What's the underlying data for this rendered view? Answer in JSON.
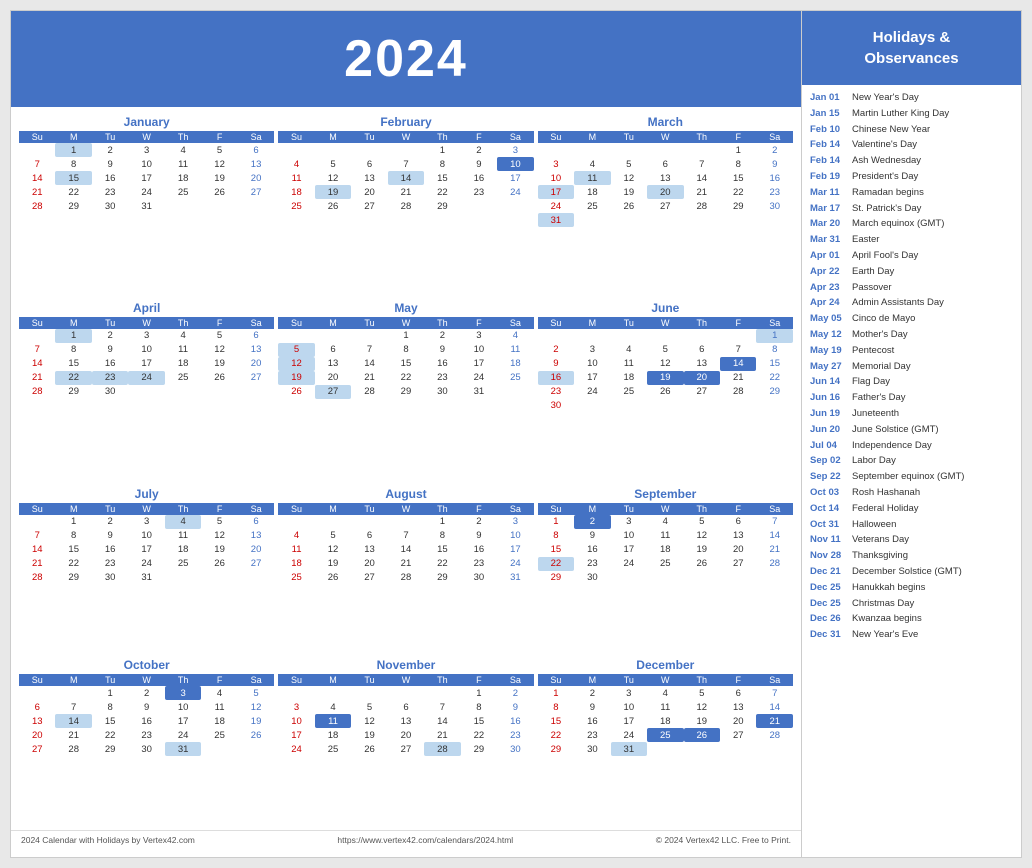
{
  "header": {
    "year": "2024"
  },
  "months": [
    {
      "name": "January",
      "days_in_month": 31,
      "start_day": 1,
      "highlights": [
        1,
        15
      ],
      "saturday_highlights": [],
      "rows": [
        [
          "",
          "1",
          "2",
          "3",
          "4",
          "5",
          "6"
        ],
        [
          "7",
          "8",
          "9",
          "10",
          "11",
          "12",
          "13"
        ],
        [
          "14",
          "15",
          "16",
          "17",
          "18",
          "19",
          "20"
        ],
        [
          "21",
          "22",
          "23",
          "24",
          "25",
          "26",
          "27"
        ],
        [
          "28",
          "29",
          "30",
          "31",
          "",
          "",
          ""
        ]
      ]
    },
    {
      "name": "February",
      "rows": [
        [
          "",
          "",
          "",
          "",
          "1",
          "2",
          "3"
        ],
        [
          "4",
          "5",
          "6",
          "7",
          "8",
          "9",
          "10"
        ],
        [
          "11",
          "12",
          "13",
          "14",
          "15",
          "16",
          "17"
        ],
        [
          "18",
          "19",
          "20",
          "21",
          "22",
          "23",
          "24"
        ],
        [
          "25",
          "26",
          "27",
          "28",
          "29",
          "",
          ""
        ]
      ],
      "highlights": [
        10,
        14,
        19
      ],
      "blue_highlights": [
        3,
        10
      ]
    },
    {
      "name": "March",
      "rows": [
        [
          "",
          "",
          "",
          "",
          "",
          "1",
          "2"
        ],
        [
          "3",
          "4",
          "5",
          "6",
          "7",
          "8",
          "9"
        ],
        [
          "10",
          "11",
          "12",
          "13",
          "14",
          "15",
          "16"
        ],
        [
          "17",
          "18",
          "19",
          "20",
          "21",
          "22",
          "23"
        ],
        [
          "24",
          "25",
          "26",
          "27",
          "28",
          "29",
          "30"
        ],
        [
          "31",
          "",
          "",
          "",
          "",
          "",
          ""
        ]
      ],
      "highlights": [
        11,
        17,
        20,
        31
      ]
    },
    {
      "name": "April",
      "rows": [
        [
          "",
          "1",
          "2",
          "3",
          "4",
          "5",
          "6"
        ],
        [
          "7",
          "8",
          "9",
          "10",
          "11",
          "12",
          "13"
        ],
        [
          "14",
          "15",
          "16",
          "17",
          "18",
          "19",
          "20"
        ],
        [
          "21",
          "22",
          "23",
          "24",
          "25",
          "26",
          "27"
        ],
        [
          "28",
          "29",
          "30",
          "",
          "",
          "",
          ""
        ]
      ],
      "highlights": [
        1,
        22,
        23,
        24
      ]
    },
    {
      "name": "May",
      "rows": [
        [
          "",
          "",
          "",
          "1",
          "2",
          "3",
          "4"
        ],
        [
          "5",
          "6",
          "7",
          "8",
          "9",
          "10",
          "11"
        ],
        [
          "12",
          "13",
          "14",
          "15",
          "16",
          "17",
          "18"
        ],
        [
          "19",
          "20",
          "21",
          "22",
          "23",
          "24",
          "25"
        ],
        [
          "26",
          "27",
          "28",
          "29",
          "30",
          "31",
          ""
        ]
      ],
      "highlights": [
        5,
        12,
        19,
        27
      ]
    },
    {
      "name": "June",
      "rows": [
        [
          "",
          "",
          "",
          "",
          "",
          "",
          "1"
        ],
        [
          "2",
          "3",
          "4",
          "5",
          "6",
          "7",
          "8"
        ],
        [
          "9",
          "10",
          "11",
          "12",
          "13",
          "14",
          "15"
        ],
        [
          "16",
          "17",
          "18",
          "19",
          "20",
          "21",
          "22"
        ],
        [
          "23",
          "24",
          "25",
          "26",
          "27",
          "28",
          "29"
        ],
        [
          "30",
          "",
          "",
          "",
          "",
          "",
          ""
        ]
      ],
      "highlights": [
        14,
        16,
        19,
        20
      ]
    },
    {
      "name": "July",
      "rows": [
        [
          "",
          "1",
          "2",
          "3",
          "4",
          "5",
          "6"
        ],
        [
          "7",
          "8",
          "9",
          "10",
          "11",
          "12",
          "13"
        ],
        [
          "14",
          "15",
          "16",
          "17",
          "18",
          "19",
          "20"
        ],
        [
          "21",
          "22",
          "23",
          "24",
          "25",
          "26",
          "27"
        ],
        [
          "28",
          "29",
          "30",
          "31",
          "",
          "",
          ""
        ]
      ],
      "highlights": [
        4
      ]
    },
    {
      "name": "August",
      "rows": [
        [
          "",
          "",
          "",
          "",
          "1",
          "2",
          "3"
        ],
        [
          "4",
          "5",
          "6",
          "7",
          "8",
          "9",
          "10"
        ],
        [
          "11",
          "12",
          "13",
          "14",
          "15",
          "16",
          "17"
        ],
        [
          "18",
          "19",
          "20",
          "21",
          "22",
          "23",
          "24"
        ],
        [
          "25",
          "26",
          "27",
          "28",
          "29",
          "30",
          "31"
        ]
      ],
      "highlights": []
    },
    {
      "name": "September",
      "rows": [
        [
          "1",
          "2",
          "3",
          "4",
          "5",
          "6",
          "7"
        ],
        [
          "8",
          "9",
          "10",
          "11",
          "12",
          "13",
          "14"
        ],
        [
          "15",
          "16",
          "17",
          "18",
          "19",
          "20",
          "21"
        ],
        [
          "22",
          "23",
          "24",
          "25",
          "26",
          "27",
          "28"
        ],
        [
          "29",
          "30",
          "",
          "",
          "",
          "",
          ""
        ]
      ],
      "highlights": [
        2,
        22
      ]
    },
    {
      "name": "October",
      "rows": [
        [
          "",
          "",
          "1",
          "2",
          "3",
          "4",
          "5"
        ],
        [
          "6",
          "7",
          "8",
          "9",
          "10",
          "11",
          "12"
        ],
        [
          "13",
          "14",
          "15",
          "16",
          "17",
          "18",
          "19"
        ],
        [
          "20",
          "21",
          "22",
          "23",
          "24",
          "25",
          "26"
        ],
        [
          "27",
          "28",
          "29",
          "30",
          "31",
          "",
          ""
        ]
      ],
      "highlights": [
        3,
        14,
        31
      ]
    },
    {
      "name": "November",
      "rows": [
        [
          "",
          "",
          "",
          "",
          "",
          "1",
          "2"
        ],
        [
          "3",
          "4",
          "5",
          "6",
          "7",
          "8",
          "9"
        ],
        [
          "10",
          "11",
          "12",
          "13",
          "14",
          "15",
          "16"
        ],
        [
          "17",
          "18",
          "19",
          "20",
          "21",
          "22",
          "23"
        ],
        [
          "24",
          "25",
          "26",
          "27",
          "28",
          "29",
          "30"
        ]
      ],
      "highlights": [
        11,
        28
      ]
    },
    {
      "name": "December",
      "rows": [
        [
          "1",
          "2",
          "3",
          "4",
          "5",
          "6",
          "7"
        ],
        [
          "8",
          "9",
          "10",
          "11",
          "12",
          "13",
          "14"
        ],
        [
          "15",
          "16",
          "17",
          "18",
          "19",
          "20",
          "21"
        ],
        [
          "22",
          "23",
          "24",
          "25",
          "26",
          "27",
          "28"
        ],
        [
          "29",
          "30",
          "31",
          "",
          "",
          "",
          ""
        ]
      ],
      "highlights": [
        21,
        25,
        26,
        31
      ]
    }
  ],
  "weekdays": [
    "Su",
    "M",
    "Tu",
    "W",
    "Th",
    "F",
    "Sa"
  ],
  "holidays_header": "Holidays &\nObservances",
  "holidays": [
    {
      "date": "Jan 01",
      "name": "New Year's Day"
    },
    {
      "date": "Jan 15",
      "name": "Martin Luther King Day"
    },
    {
      "date": "Feb 10",
      "name": "Chinese New Year"
    },
    {
      "date": "Feb 14",
      "name": "Valentine's Day"
    },
    {
      "date": "Feb 14",
      "name": "Ash Wednesday"
    },
    {
      "date": "Feb 19",
      "name": "President's Day"
    },
    {
      "date": "Mar 11",
      "name": "Ramadan begins"
    },
    {
      "date": "Mar 17",
      "name": "St. Patrick's Day"
    },
    {
      "date": "Mar 20",
      "name": "March equinox (GMT)"
    },
    {
      "date": "Mar 31",
      "name": "Easter"
    },
    {
      "date": "Apr 01",
      "name": "April Fool's Day"
    },
    {
      "date": "Apr 22",
      "name": "Earth Day"
    },
    {
      "date": "Apr 23",
      "name": "Passover"
    },
    {
      "date": "Apr 24",
      "name": "Admin Assistants Day"
    },
    {
      "date": "May 05",
      "name": "Cinco de Mayo"
    },
    {
      "date": "May 12",
      "name": "Mother's Day"
    },
    {
      "date": "May 19",
      "name": "Pentecost"
    },
    {
      "date": "May 27",
      "name": "Memorial Day"
    },
    {
      "date": "Jun 14",
      "name": "Flag Day"
    },
    {
      "date": "Jun 16",
      "name": "Father's Day"
    },
    {
      "date": "Jun 19",
      "name": "Juneteenth"
    },
    {
      "date": "Jun 20",
      "name": "June Solstice (GMT)"
    },
    {
      "date": "Jul 04",
      "name": "Independence Day"
    },
    {
      "date": "Sep 02",
      "name": "Labor Day"
    },
    {
      "date": "Sep 22",
      "name": "September equinox (GMT)"
    },
    {
      "date": "Oct 03",
      "name": "Rosh Hashanah"
    },
    {
      "date": "Oct 14",
      "name": "Federal Holiday"
    },
    {
      "date": "Oct 31",
      "name": "Halloween"
    },
    {
      "date": "Nov 11",
      "name": "Veterans Day"
    },
    {
      "date": "Nov 28",
      "name": "Thanksgiving"
    },
    {
      "date": "Dec 21",
      "name": "December Solstice (GMT)"
    },
    {
      "date": "Dec 25",
      "name": "Hanukkah begins"
    },
    {
      "date": "Dec 25",
      "name": "Christmas Day"
    },
    {
      "date": "Dec 26",
      "name": "Kwanzaa begins"
    },
    {
      "date": "Dec 31",
      "name": "New Year's Eve"
    }
  ],
  "footer": {
    "left": "2024 Calendar with Holidays by Vertex42.com",
    "center": "https://www.vertex42.com/calendars/2024.html",
    "right": "© 2024 Vertex42 LLC. Free to Print."
  }
}
